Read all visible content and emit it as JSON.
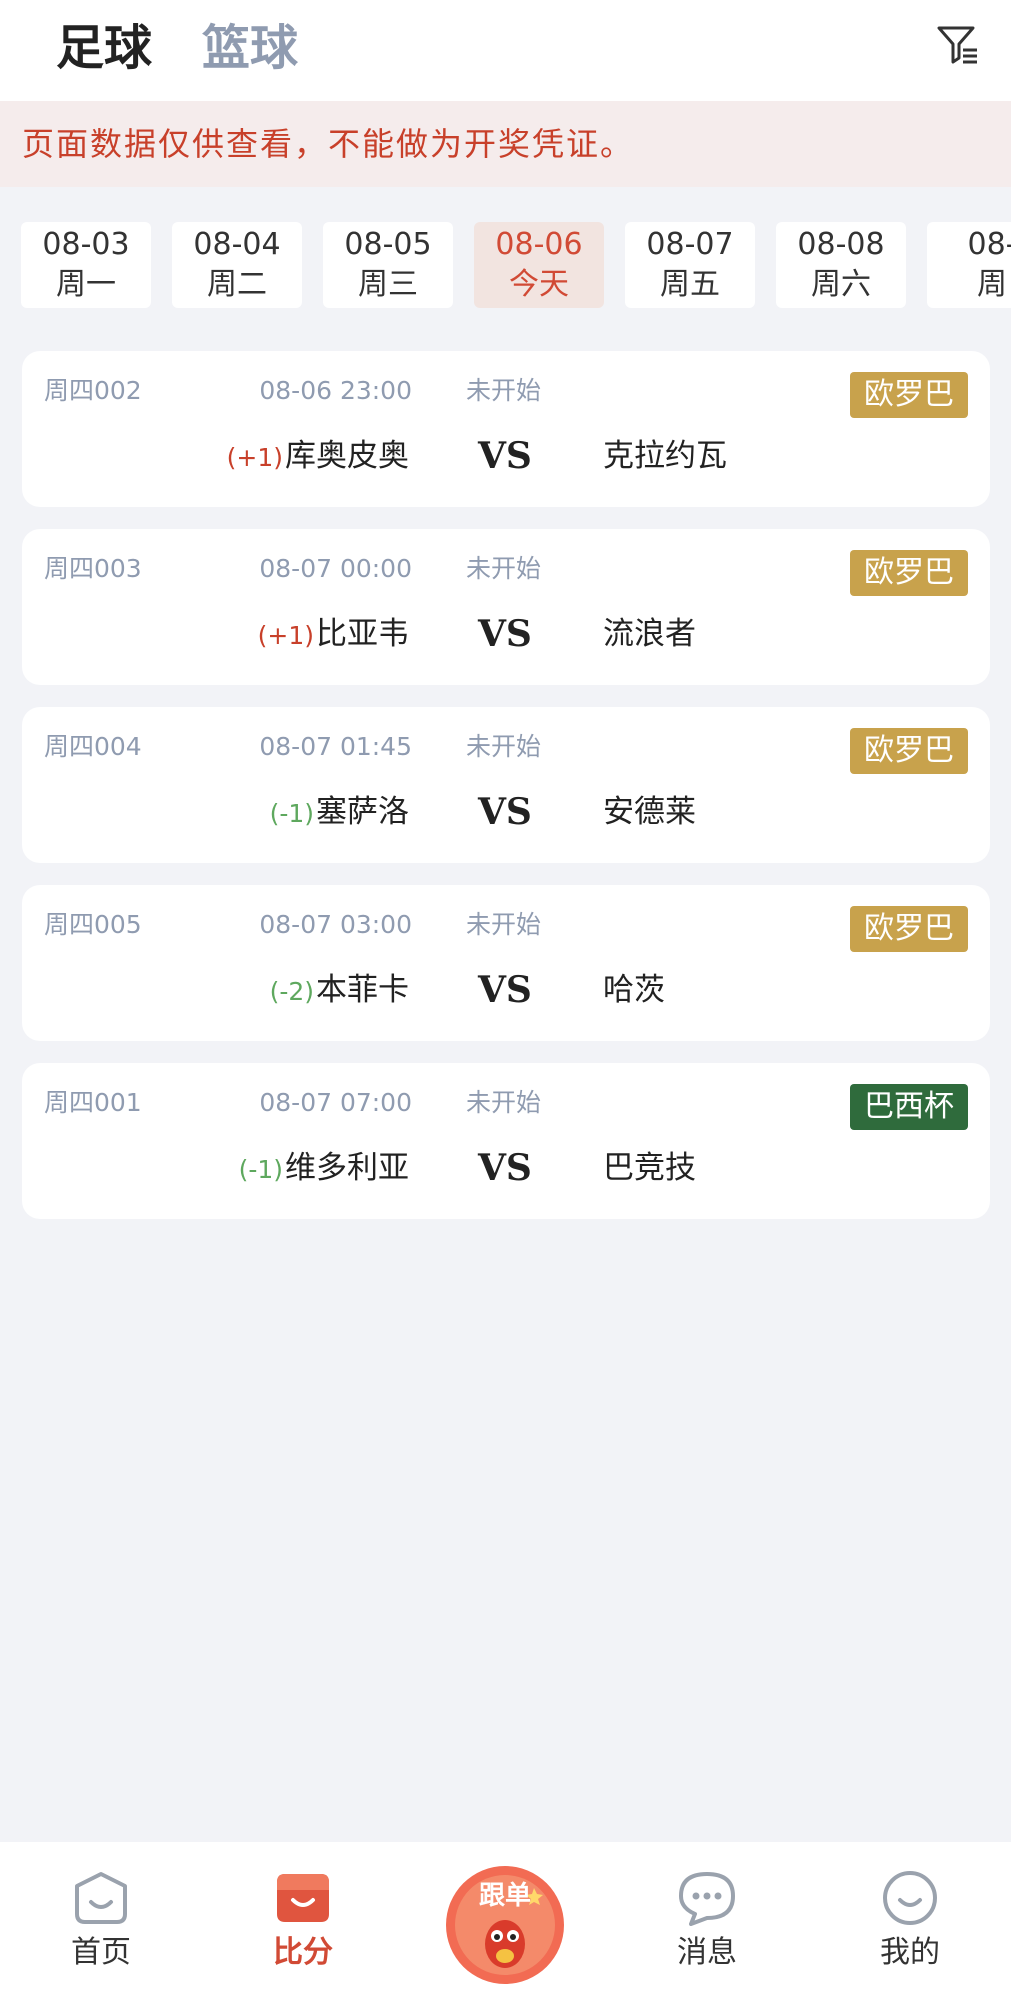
{
  "tabs": {
    "football": "足球",
    "basketball": "篮球"
  },
  "notice": "页面数据仅供查看，不能做为开奖凭证。",
  "dates": [
    {
      "date": "08-03",
      "week": "周一"
    },
    {
      "date": "08-04",
      "week": "周二"
    },
    {
      "date": "08-05",
      "week": "周三"
    },
    {
      "date": "08-06",
      "week": "今天"
    },
    {
      "date": "08-07",
      "week": "周五"
    },
    {
      "date": "08-08",
      "week": "周六"
    },
    {
      "date": "08-",
      "week": "周"
    }
  ],
  "matches": [
    {
      "code": "周四002",
      "time": "08-06 23:00",
      "status": "未开始",
      "league": "欧罗巴",
      "league_color": "#c8a24c",
      "handicap": "(+1)",
      "handicap_color": "#c8402a",
      "home": "库奥皮奥",
      "vs": "VS",
      "away": "克拉约瓦"
    },
    {
      "code": "周四003",
      "time": "08-07 00:00",
      "status": "未开始",
      "league": "欧罗巴",
      "league_color": "#c8a24c",
      "handicap": "(+1)",
      "handicap_color": "#c8402a",
      "home": "比亚韦",
      "vs": "VS",
      "away": "流浪者"
    },
    {
      "code": "周四004",
      "time": "08-07 01:45",
      "status": "未开始",
      "league": "欧罗巴",
      "league_color": "#c8a24c",
      "handicap": "(-1)",
      "handicap_color": "#5ea85e",
      "home": "塞萨洛",
      "vs": "VS",
      "away": "安德莱"
    },
    {
      "code": "周四005",
      "time": "08-07 03:00",
      "status": "未开始",
      "league": "欧罗巴",
      "league_color": "#c8a24c",
      "handicap": "(-2)",
      "handicap_color": "#5ea85e",
      "home": "本菲卡",
      "vs": "VS",
      "away": "哈茨"
    },
    {
      "code": "周四001",
      "time": "08-07 07:00",
      "status": "未开始",
      "league": "巴西杯",
      "league_color": "#2f6b3c",
      "handicap": "(-1)",
      "handicap_color": "#5ea85e",
      "home": "维多利亚",
      "vs": "VS",
      "away": "巴竞技"
    }
  ],
  "nav": {
    "home": "首页",
    "score": "比分",
    "follow": "跟单",
    "messages": "消息",
    "mine": "我的"
  },
  "colors": {
    "accent": "#d14a35",
    "muted": "#8f9bb0"
  }
}
